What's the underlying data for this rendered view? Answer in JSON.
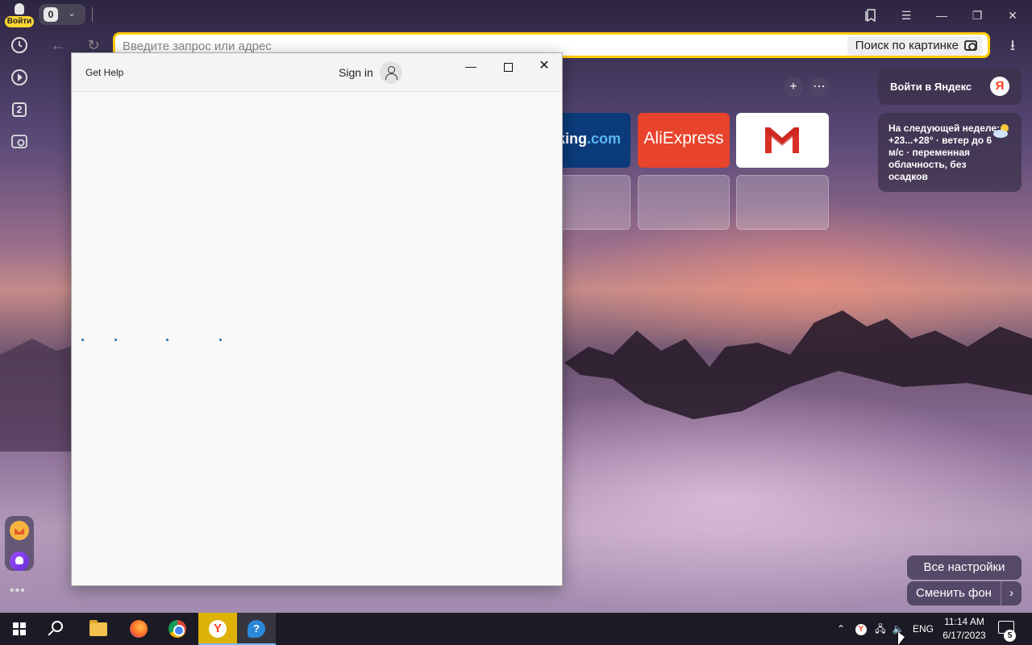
{
  "browser": {
    "login_badge": "Войти",
    "tab_count": "0",
    "address_placeholder": "Введите запрос или адрес",
    "image_search_label": "Поиск по картинке",
    "sidebar_tab_number": "2"
  },
  "tiles": [
    {
      "label": "oking",
      "suffix": ".com"
    },
    {
      "label": "AliExpress"
    },
    {
      "label": "M"
    }
  ],
  "widgets": {
    "yandex_login": "Войти в Яндекс",
    "yandex_logo": "Я",
    "weather_text": "На следующей неделе: +23...+28° · ветер до 6 м/с · переменная облачность, без осадков"
  },
  "buttons": {
    "all_settings": "Все настройки",
    "change_background": "Сменить фон"
  },
  "get_help": {
    "title": "Get Help",
    "sign_in": "Sign in"
  },
  "taskbar": {
    "language": "ENG",
    "time": "11:14 AM",
    "date": "6/17/2023",
    "notification_count": "5",
    "yandex_glyph": "Y",
    "help_glyph": "?"
  },
  "colors": {
    "address_border": "#ffcc00",
    "aliexpress": "#e8432c",
    "booking": "#0b3b7a",
    "yandex_red": "#fc3f1d"
  }
}
